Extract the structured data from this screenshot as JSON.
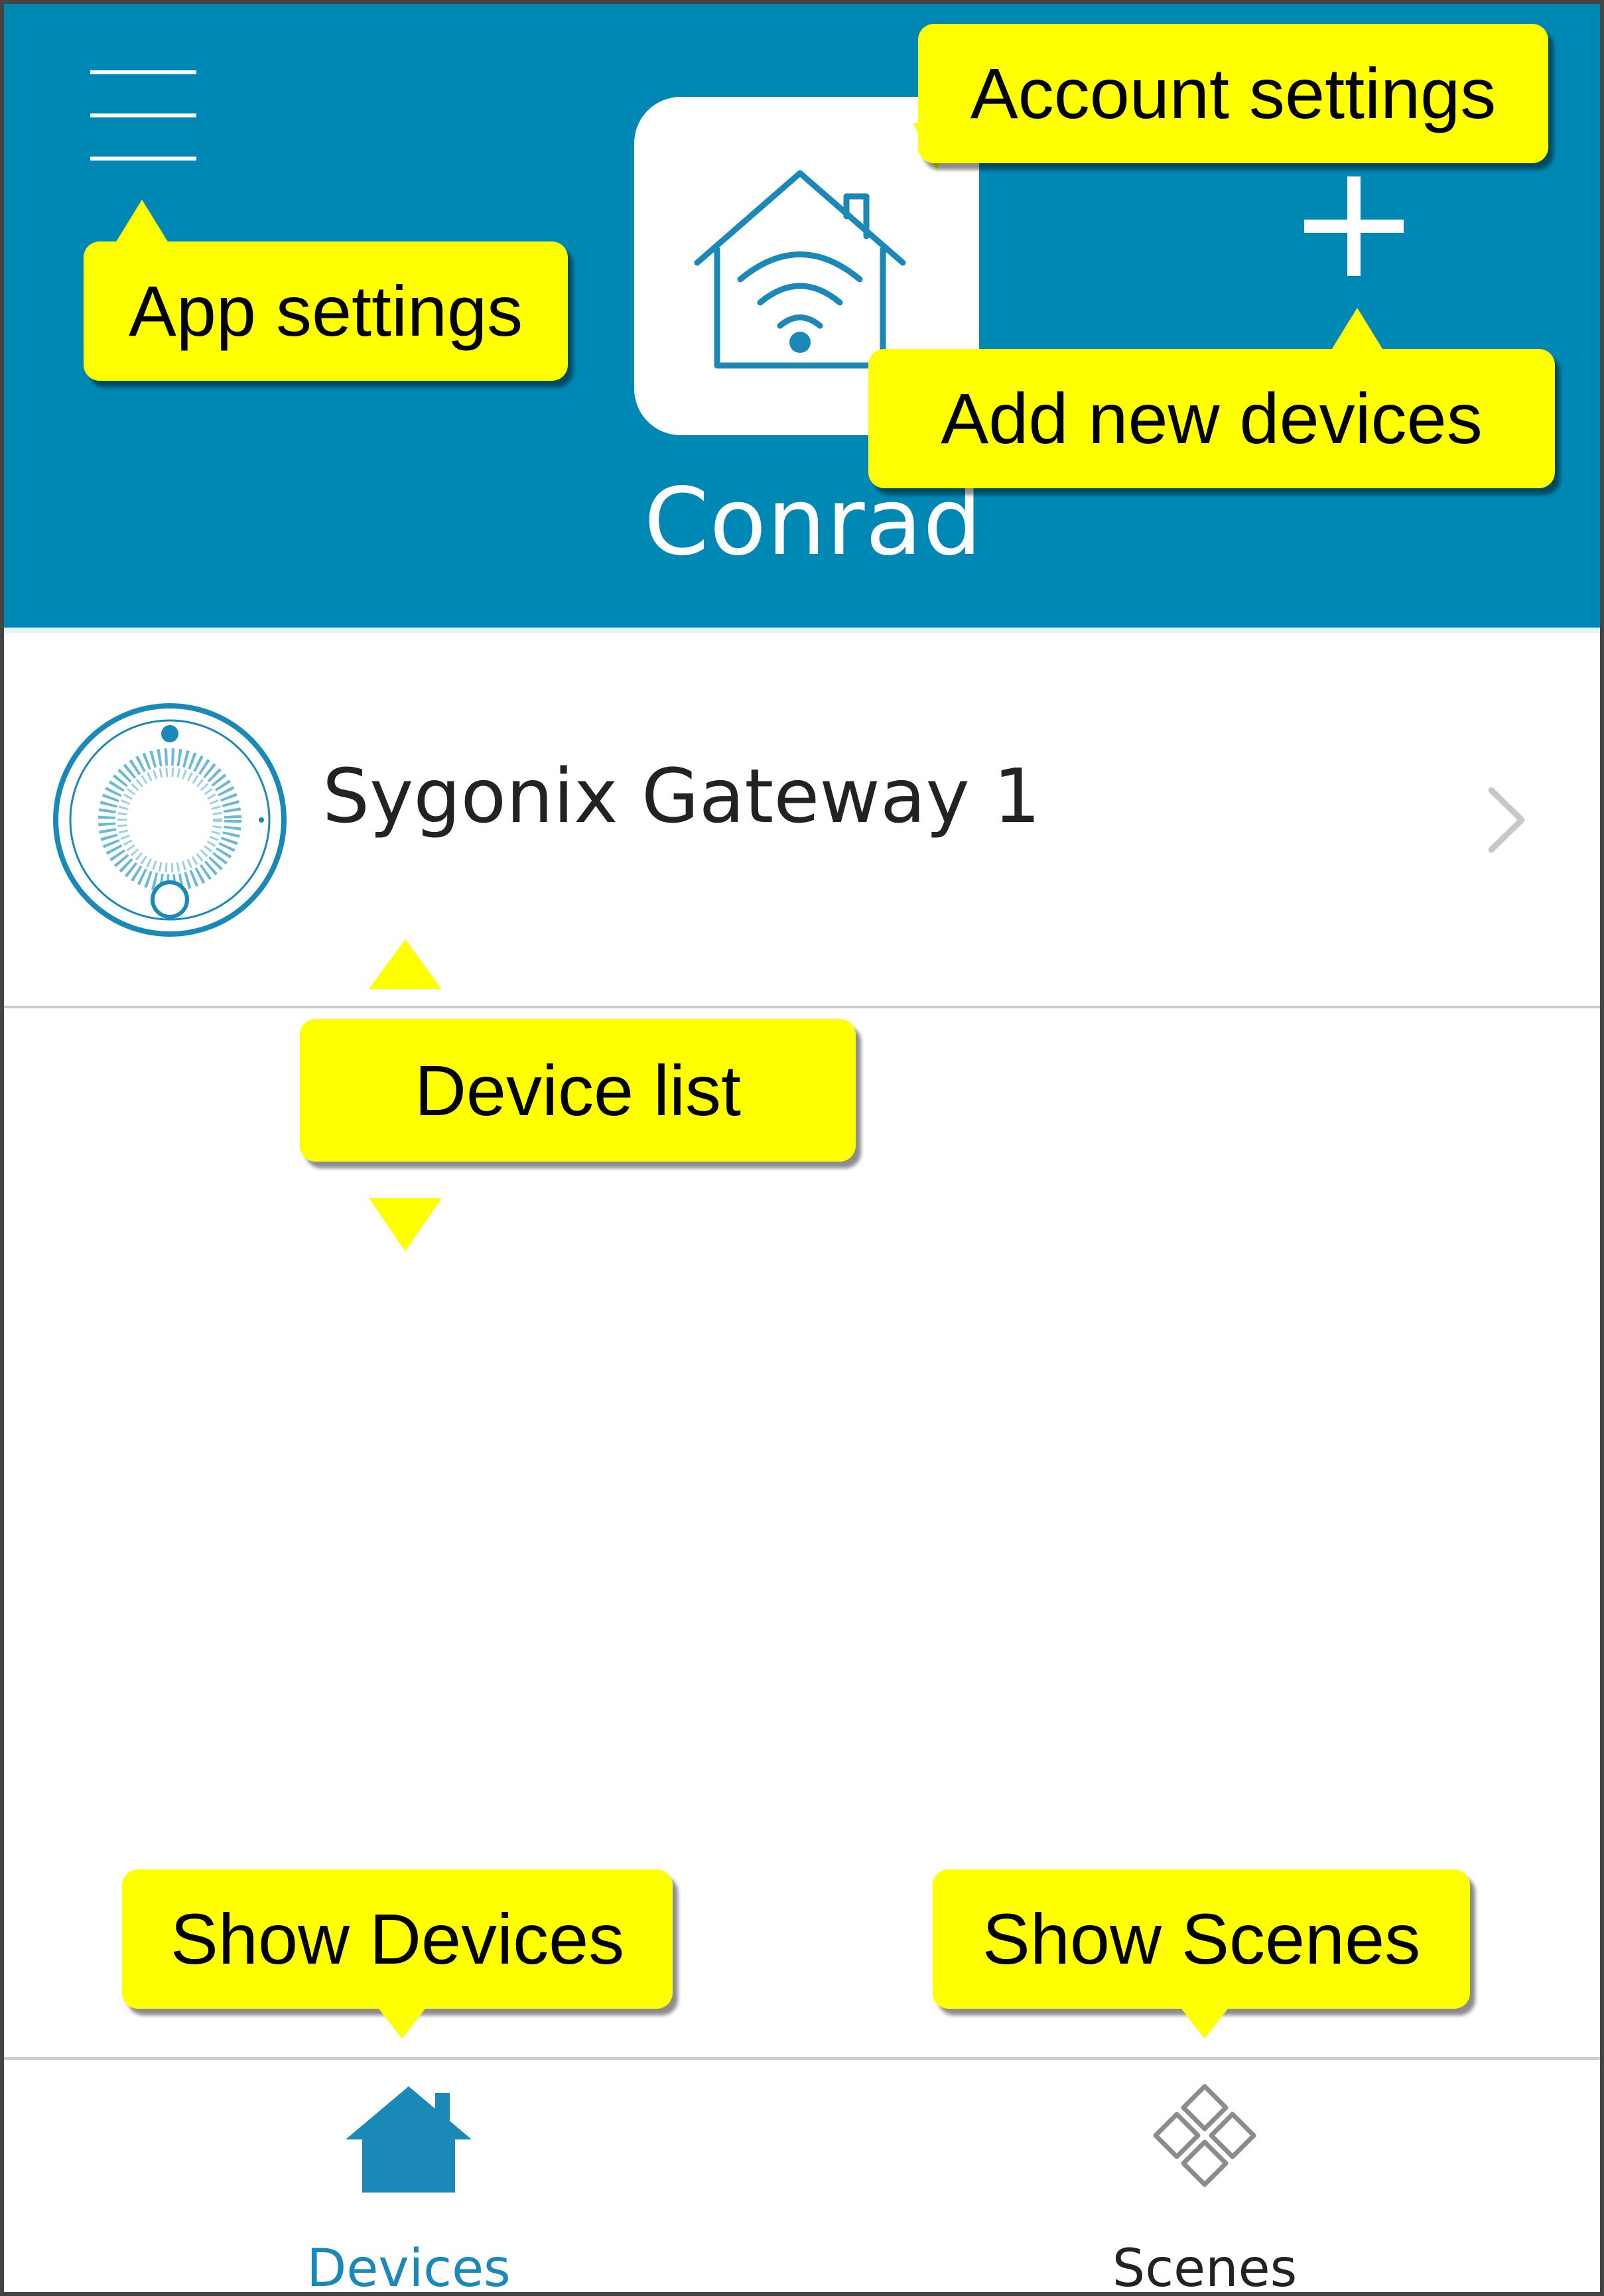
{
  "header": {
    "account_name": "Conrad",
    "background_color": "#0088b4",
    "icons": {
      "menu": "hamburger-menu-icon",
      "logo": "smart-home-wifi-icon",
      "add": "plus-icon"
    }
  },
  "devices": [
    {
      "name": "Sygonix Gateway 1",
      "icon": "gateway-device-icon"
    }
  ],
  "tabbar": {
    "tabs": [
      {
        "label": "Devices",
        "icon": "house-icon",
        "active": true
      },
      {
        "label": "Scenes",
        "icon": "scenes-diamond-icon",
        "active": false
      }
    ],
    "active_color": "#1a89b8"
  },
  "callouts": {
    "account_settings": "Account settings",
    "app_settings": "App settings",
    "add_new_devices": "Add new devices",
    "device_list": "Device list",
    "show_devices": "Show Devices",
    "show_scenes": "Show Scenes",
    "color": "#ffff00"
  }
}
